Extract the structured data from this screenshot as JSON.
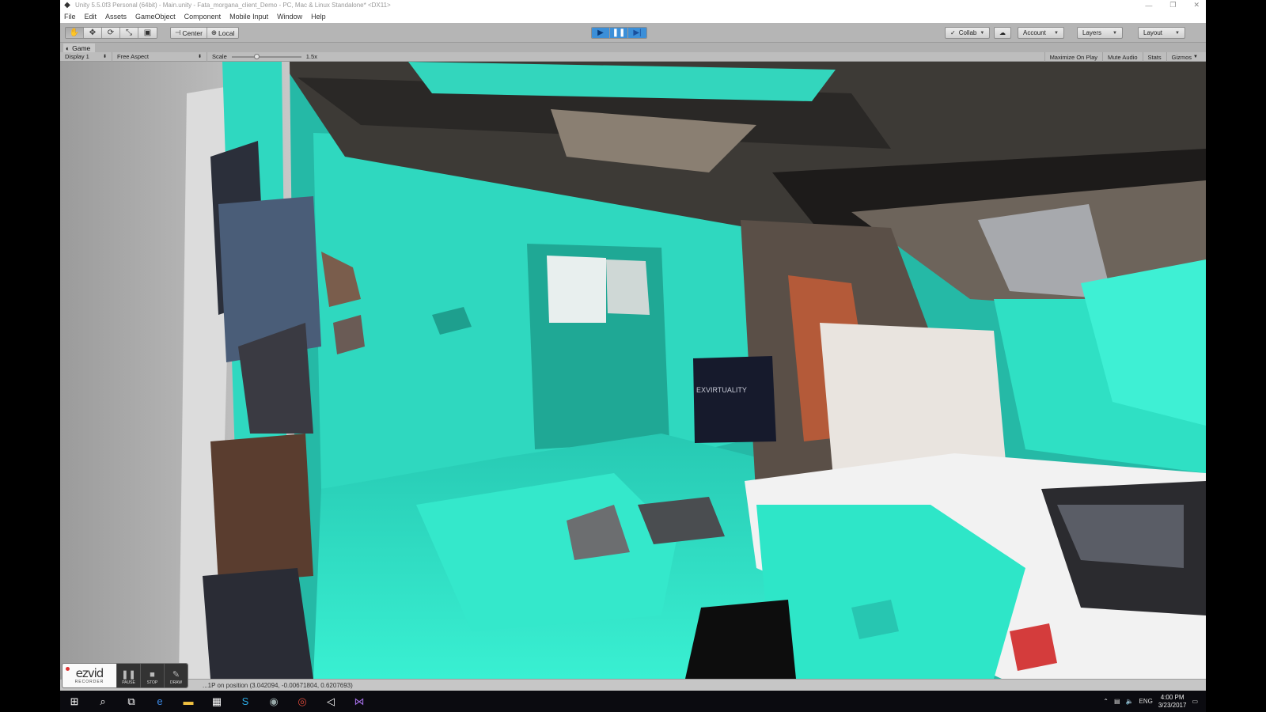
{
  "window": {
    "title": "Unity 5.5.0f3 Personal (64bit) - Main.unity - Fata_morgana_client_Demo - PC, Mac & Linux Standalone* <DX11>",
    "controls": [
      "—",
      "❐",
      "✕"
    ]
  },
  "menu": [
    "File",
    "Edit",
    "Assets",
    "GameObject",
    "Component",
    "Mobile Input",
    "Window",
    "Help"
  ],
  "toolbar": {
    "transform_tools": [
      {
        "name": "hand-tool-icon",
        "glyph": "✋"
      },
      {
        "name": "move-tool-icon",
        "glyph": "✥"
      },
      {
        "name": "rotate-tool-icon",
        "glyph": "⟳"
      },
      {
        "name": "scale-tool-icon",
        "glyph": "⤡"
      },
      {
        "name": "rect-tool-icon",
        "glyph": "▣"
      }
    ],
    "pivot_label": "Center",
    "space_label": "Local",
    "collab_label": "Collab",
    "account_label": "Account",
    "layers_label": "Layers",
    "layout_label": "Layout"
  },
  "game_view": {
    "tab_label": "Game",
    "display_label": "Display 1",
    "aspect_label": "Free Aspect",
    "scale_label": "Scale",
    "scale_value": "1.5x",
    "scale_fraction": 0.35,
    "maximize_label": "Maximize On Play",
    "mute_label": "Mute Audio",
    "stats_label": "Stats",
    "gizmos_label": "Gizmos"
  },
  "scene": {
    "banner_text": "EXVIRTUALITY"
  },
  "status": {
    "message": "...1P on position (3.042094, -0.00671804, 0.6207693)"
  },
  "recorder": {
    "brand": "ezvid",
    "sub": "RECORDER",
    "buttons": [
      "PAUSE",
      "STOP",
      "DRAW"
    ]
  },
  "taskbar": {
    "language": "ENG",
    "time": "4:00 PM",
    "date": "3/23/2017"
  },
  "colors": {
    "teal": "#2ee6c8",
    "play_blue": "#3c8fd8"
  }
}
